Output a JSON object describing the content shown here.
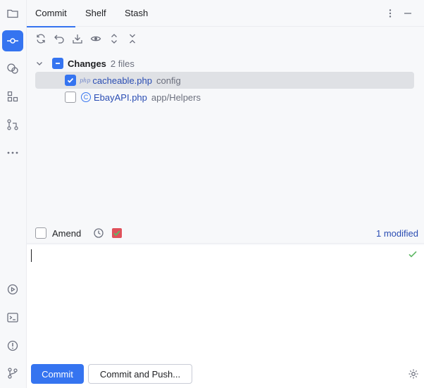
{
  "tabs": [
    {
      "label": "Commit",
      "active": true
    },
    {
      "label": "Shelf",
      "active": false
    },
    {
      "label": "Stash",
      "active": false
    }
  ],
  "tab_controls": {
    "options_icon": "more-vertical-icon",
    "minimize_icon": "minimize-icon"
  },
  "toolstrip": [
    {
      "icon": "folder-icon",
      "active": false
    },
    {
      "icon": "commit-icon",
      "active": true
    },
    {
      "icon": "plugins-icon",
      "active": false
    },
    {
      "icon": "structure-icon",
      "active": false
    },
    {
      "icon": "pull-requests-icon",
      "active": false
    },
    {
      "icon": "more-icon",
      "active": false
    },
    {
      "icon": "services-icon",
      "active": false
    },
    {
      "icon": "terminal-icon",
      "active": false
    },
    {
      "icon": "problems-icon",
      "active": false
    },
    {
      "icon": "git-icon",
      "active": false
    }
  ],
  "toolbar": [
    "refresh-icon",
    "rollback-icon",
    "update-icon",
    "preview-diff-icon",
    "expand-all-icon",
    "collapse-all-icon"
  ],
  "changes": {
    "group_label": "Changes",
    "group_count": "2 files",
    "files": [
      {
        "type_icon": "php",
        "name": "cacheable.php",
        "path": "config",
        "checked": true,
        "selected": true
      },
      {
        "type_icon": "©",
        "name": "EbayAPI.php",
        "path": "app/Helpers",
        "checked": false,
        "selected": false
      }
    ]
  },
  "amend": {
    "label": "Amend",
    "modified": "1 modified"
  },
  "commit_message": {
    "value": ""
  },
  "buttons": {
    "commit": "Commit",
    "commit_and_push": "Commit and Push..."
  },
  "colors": {
    "accent": "#3574f0",
    "file_text": "#2a4db3",
    "selected_row": "#dfe1e5",
    "check_ok": "#5fb865"
  }
}
